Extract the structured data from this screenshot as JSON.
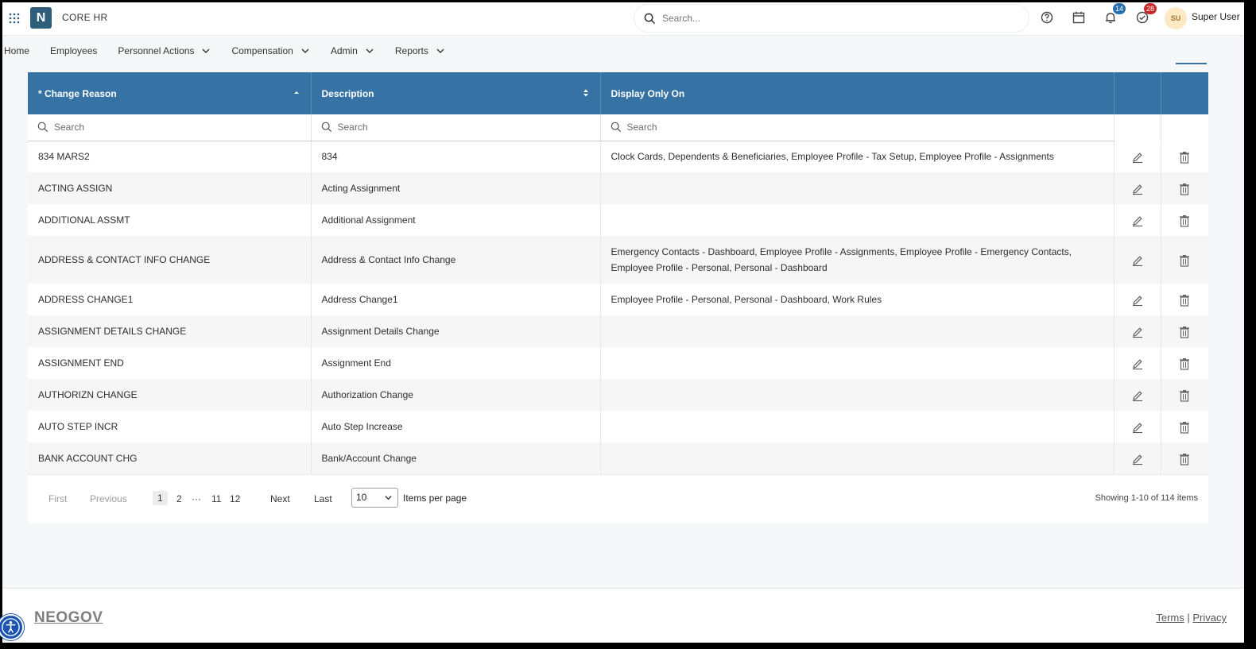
{
  "app": {
    "logo_letter": "N",
    "name": "CORE HR"
  },
  "search": {
    "placeholder": "Search..."
  },
  "topbar": {
    "notifications_count": "14",
    "tasks_count": "28",
    "user_initials": "SU",
    "user_name": "Super User",
    "colors": {
      "notif_badge": "#2a6fb0",
      "tasks_badge": "#c62828",
      "accent": "#3672a4"
    }
  },
  "nav": {
    "items": [
      {
        "label": "Home",
        "dropdown": false
      },
      {
        "label": "Employees",
        "dropdown": false
      },
      {
        "label": "Personnel Actions",
        "dropdown": true
      },
      {
        "label": "Compensation",
        "dropdown": true
      },
      {
        "label": "Admin",
        "dropdown": true
      },
      {
        "label": "Reports",
        "dropdown": true
      }
    ]
  },
  "grid": {
    "columns": [
      {
        "label": "* Change Reason",
        "sort": "ascending"
      },
      {
        "label": "Description",
        "sort": "unsorted"
      },
      {
        "label": "Display Only On",
        "sort": null
      }
    ],
    "filter_placeholder": "Search",
    "rows": [
      {
        "reason": "834 MARS2",
        "description": "834",
        "display": "Clock Cards, Dependents & Beneficiaries, Employee Profile - Tax Setup, Employee Profile - Assignments"
      },
      {
        "reason": "ACTING ASSIGN",
        "description": "Acting Assignment",
        "display": ""
      },
      {
        "reason": "ADDITIONAL ASSMT",
        "description": "Additional Assignment",
        "display": ""
      },
      {
        "reason": "ADDRESS & CONTACT INFO CHANGE",
        "description": "Address & Contact Info Change",
        "display": "Emergency Contacts - Dashboard, Employee Profile - Assignments, Employee Profile - Emergency Contacts, Employee Profile - Personal, Personal - Dashboard"
      },
      {
        "reason": "ADDRESS CHANGE1",
        "description": "Address Change1",
        "display": "Employee Profile - Personal, Personal - Dashboard, Work Rules"
      },
      {
        "reason": "ASSIGNMENT DETAILS CHANGE",
        "description": "Assignment Details Change",
        "display": ""
      },
      {
        "reason": "ASSIGNMENT END",
        "description": "Assignment End",
        "display": ""
      },
      {
        "reason": "AUTHORIZN CHANGE",
        "description": "Authorization Change",
        "display": ""
      },
      {
        "reason": "AUTO STEP INCR",
        "description": "Auto Step Increase",
        "display": ""
      },
      {
        "reason": "BANK ACCOUNT CHG",
        "description": "Bank/Account Change",
        "display": ""
      }
    ]
  },
  "pager": {
    "first": "First",
    "previous": "Previous",
    "pages": [
      "1",
      "2",
      "11",
      "12"
    ],
    "current_page": "1",
    "ellipsis": "···",
    "next": "Next",
    "last": "Last",
    "page_size": "10",
    "items_per_page_label": "Items per page",
    "summary": "Showing 1-10 of 114 items"
  },
  "footer": {
    "brand": "NEOGOV",
    "terms": "Terms",
    "separator": "|",
    "privacy": "Privacy"
  }
}
